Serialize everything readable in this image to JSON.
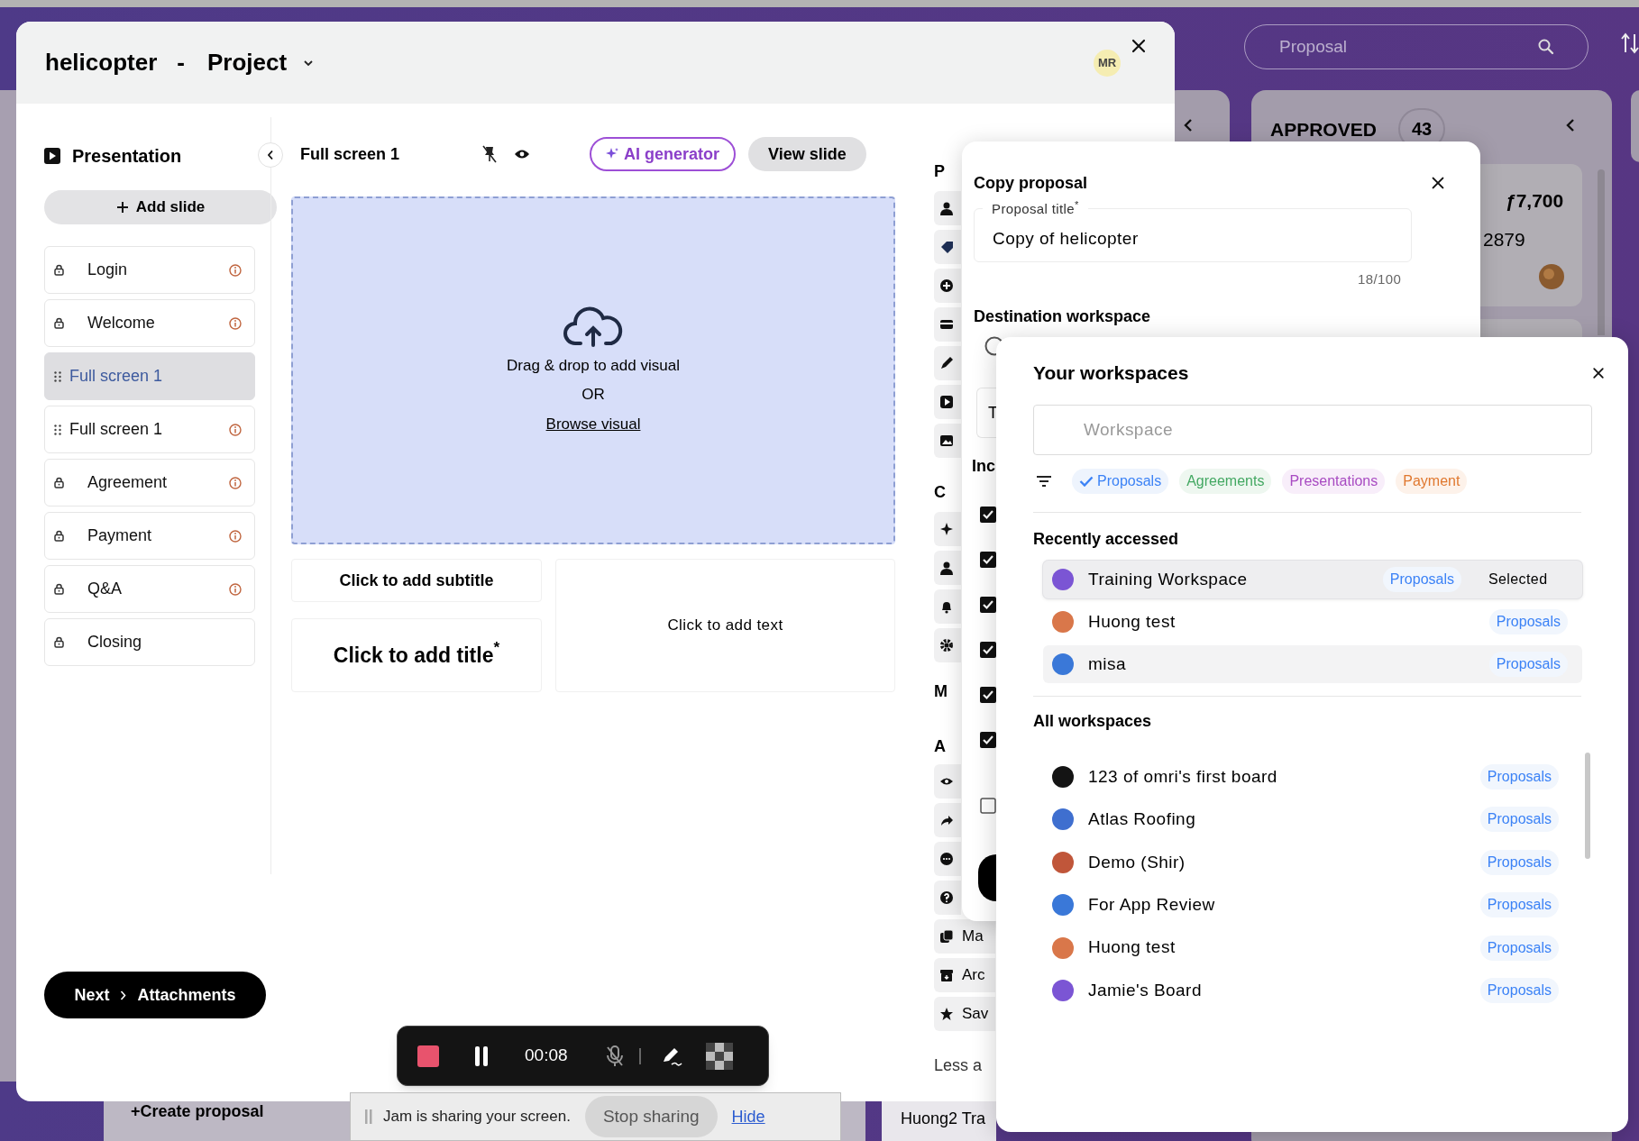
{
  "board": {
    "search_placeholder": "Proposal",
    "column": {
      "title": "APPROVED",
      "count": "43",
      "amount": "ƒ7,700",
      "number": "2879"
    },
    "create_button": "+Create proposal",
    "card_fragment": "Huong2 Tra"
  },
  "modal": {
    "title_name": "helicopter",
    "title_separator": "-",
    "title_type": "Project",
    "avatar": "MR"
  },
  "presentation": {
    "heading": "Presentation",
    "add_button": "Add slide",
    "slides": [
      {
        "label": "Login",
        "kind": "locked",
        "selected": false,
        "warning": true
      },
      {
        "label": "Welcome",
        "kind": "locked",
        "selected": false,
        "warning": true
      },
      {
        "label": "Full screen 1",
        "kind": "draggable",
        "selected": true,
        "warning": false
      },
      {
        "label": "Full screen 1",
        "kind": "draggable",
        "selected": false,
        "warning": true
      },
      {
        "label": "Agreement",
        "kind": "locked",
        "selected": false,
        "warning": true
      },
      {
        "label": "Payment",
        "kind": "locked",
        "selected": false,
        "warning": true
      },
      {
        "label": "Q&A",
        "kind": "locked",
        "selected": false,
        "warning": true
      },
      {
        "label": "Closing",
        "kind": "locked",
        "selected": false,
        "warning": false
      }
    ],
    "next_button": {
      "label": "Next",
      "target": "Attachments"
    }
  },
  "editor": {
    "slide_title": "Full screen 1",
    "ai_button": "AI generator",
    "view_button": "View slide",
    "drop_text": "Drag & drop to add visual",
    "drop_or": "OR",
    "browse_link": "Browse visual",
    "subtitle_placeholder": "Click to add subtitle",
    "title_placeholder": "Click to add title$^{*}$",
    "text_placeholder": "Click to add text"
  },
  "side_panel": {
    "fragments": [
      "P",
      "C",
      "M",
      "A"
    ],
    "rows": [
      "Ma",
      "Arc",
      "Sav"
    ],
    "footer": "Less a"
  },
  "copy_dialog": {
    "title": "Copy proposal",
    "field_label": "Proposal title$^{*}$",
    "field_value": "Copy of helicopter",
    "counter": "18/100",
    "destination_heading": "Destination workspace",
    "option_fragment": "T",
    "include_fragment": "Inc",
    "include_options": [
      {
        "checked": true
      },
      {
        "checked": true
      },
      {
        "checked": true
      },
      {
        "checked": true
      },
      {
        "checked": true
      },
      {
        "checked": true
      },
      {
        "checked": false
      }
    ]
  },
  "workspace_picker": {
    "title": "Your workspaces",
    "search_placeholder": "Workspace",
    "filters": [
      {
        "label": "Proposals",
        "selected": true,
        "color": "#3b82f6"
      },
      {
        "label": "Agreements",
        "selected": false,
        "color": "#43a862"
      },
      {
        "label": "Presentations",
        "selected": false,
        "color": "#a84bc2"
      },
      {
        "label": "Payment",
        "selected": false,
        "color": "#e0782f"
      }
    ],
    "recent_heading": "Recently accessed",
    "recent": [
      {
        "name": "Training Workspace",
        "color": "#7b55d4",
        "tag": "Proposals",
        "status": "Selected",
        "selected": true,
        "hovered": false
      },
      {
        "name": "Huong test",
        "color": "#d9774a",
        "tag": "Proposals",
        "selected": false,
        "hovered": false
      },
      {
        "name": "misa",
        "color": "#3a78d8",
        "tag": "Proposals",
        "selected": false,
        "hovered": true
      }
    ],
    "all_heading": "All workspaces",
    "all": [
      {
        "name": "123 of omri's first board",
        "color": "#141414",
        "tag": "Proposals"
      },
      {
        "name": "Atlas Roofing",
        "color": "#3f6fcf",
        "tag": "Proposals"
      },
      {
        "name": "Demo (Shir)",
        "color": "#c0563a",
        "tag": "Proposals"
      },
      {
        "name": "For App Review",
        "color": "#3a78d8",
        "tag": "Proposals"
      },
      {
        "name": "Huong test",
        "color": "#d9774a",
        "tag": "Proposals"
      },
      {
        "name": "Jamie's Board",
        "color": "#7b55d4",
        "tag": "Proposals"
      }
    ]
  },
  "recorder": {
    "time": "00:08"
  },
  "jam_bar": {
    "message": "Jam is sharing your screen.",
    "stop_button": "Stop sharing",
    "hide_link": "Hide"
  }
}
